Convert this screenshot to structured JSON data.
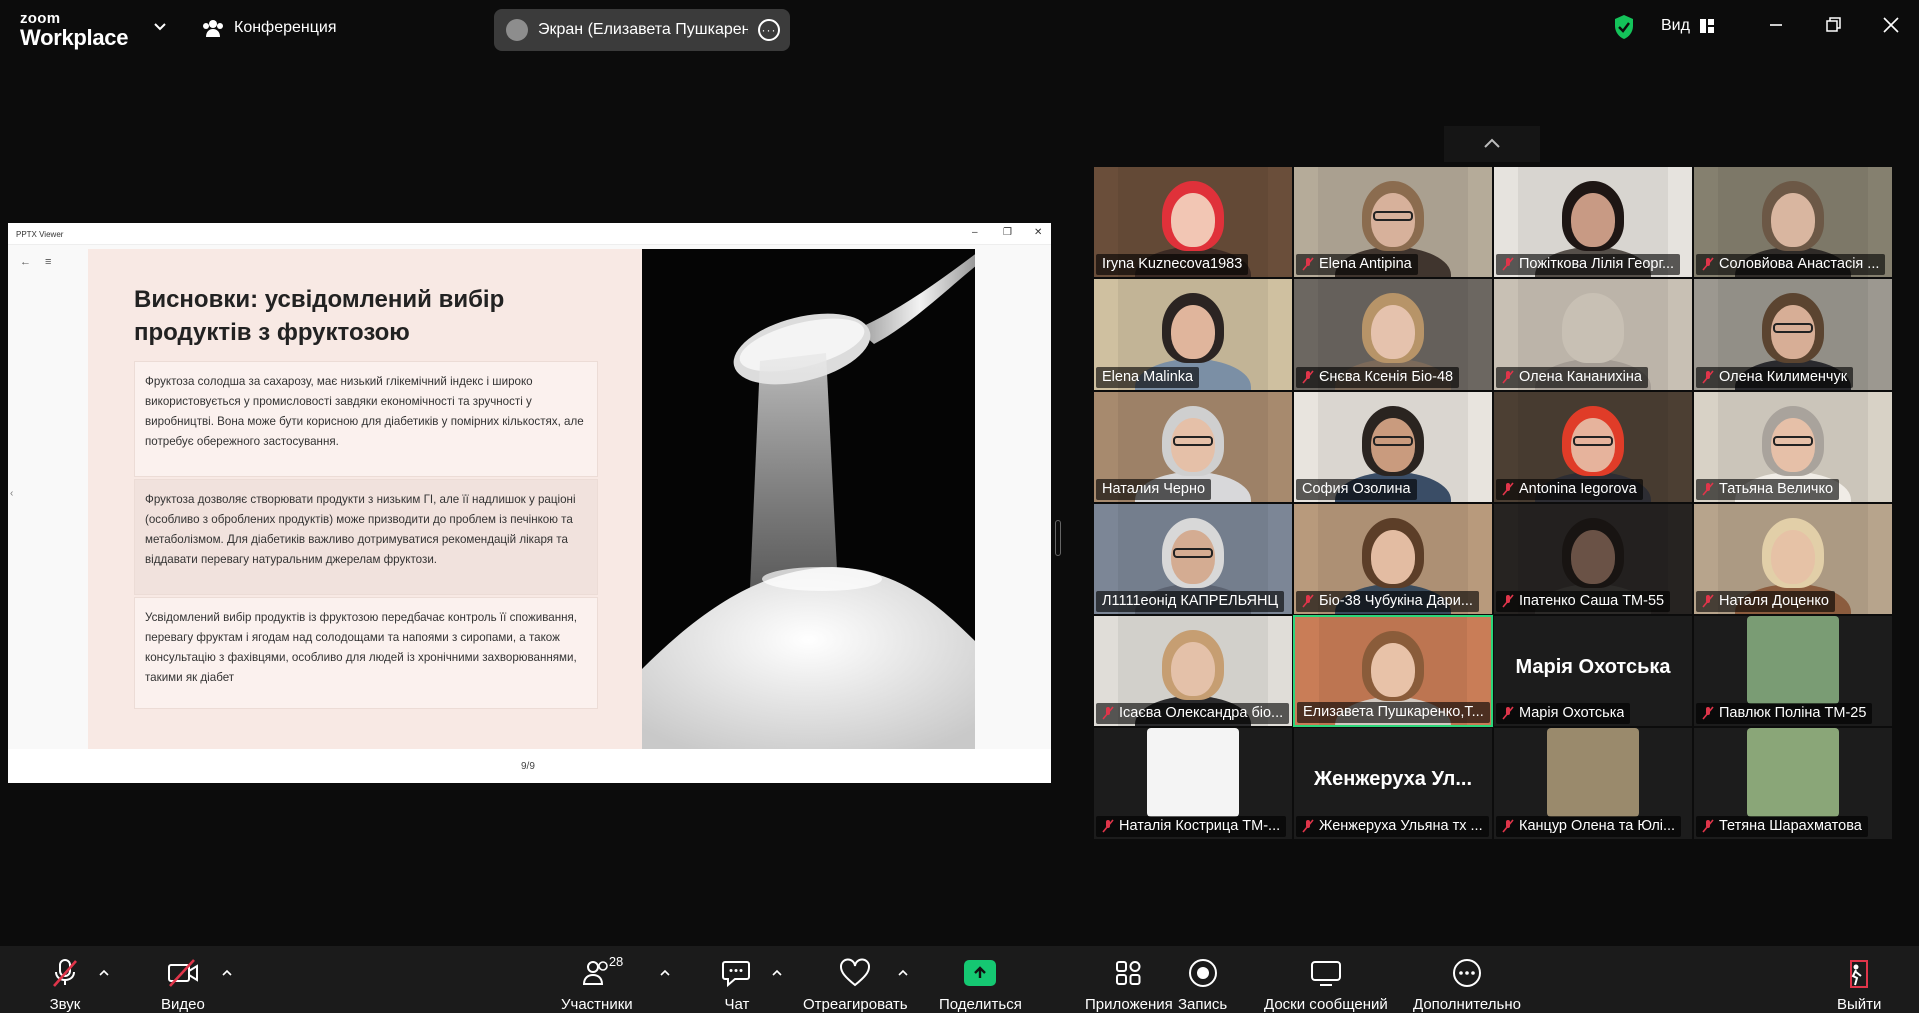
{
  "window": {
    "brand_top": "zoom",
    "brand_bottom": "Workplace",
    "meeting_label": "Конференция",
    "screen_share_label": "Экран (Елизавета Пушкаренко,",
    "view_label": "Вид"
  },
  "shared": {
    "app_title": "PPTX Viewer",
    "slide_title": "Висновки: усвідомлений вибір продуктів з фруктозою",
    "paragraphs": [
      "Фруктоза солодша за сахарозу, має низький глікемічний індекс і широко використовується у промисловості завдяки економічності та зручності у виробництві. Вона може бути корисною для діабетиків у помірних кількостях, але потребує обережного застосування.",
      "Фруктоза дозволяє створювати продукти з низьким ГІ, але її надлишок у раціоні (особливо з оброблених продуктів) може призводити до проблем із печінкою та метаболізмом. Для діабетиків важливо дотримуватися рекомендацій лікаря та віддавати перевагу натуральним джерелам фруктози.",
      "Усвідомлений вибір продуктів із фруктозою передбачає контроль її споживання, перевагу фруктам і ягодам над солодощами та напоями з сиропами, а також консультацію  з фахівцями, особливо для людей із хронічними захворюваннями, такими як діабет"
    ],
    "page_indicator": "9/9"
  },
  "participants": [
    {
      "name": "Iryna Kuznecova1983",
      "muted": false,
      "bg": "#6a4e3a",
      "hair": "#e0313a",
      "shirt": "#3b2a24",
      "face": "#f2c6b4",
      "glasses": false
    },
    {
      "name": "Elena Antipina",
      "muted": true,
      "bg": "#b5ab99",
      "hair": "#8b6c4f",
      "shirt": "#40352e",
      "face": "#d7b19b",
      "glasses": true
    },
    {
      "name": "Пожіткова Лілія Георг...",
      "muted": true,
      "bg": "#e6e3de",
      "hair": "#1e1614",
      "shirt": "#56504a",
      "face": "#c89a84",
      "glasses": false
    },
    {
      "name": "Соловйова Анастасія ...",
      "muted": true,
      "bg": "#85806f",
      "hair": "#6c5846",
      "shirt": "#2f2b28",
      "face": "#d9b6a0",
      "glasses": false
    },
    {
      "name": "Elena Malinka",
      "muted": false,
      "bg": "#cfc0a0",
      "hair": "#2b2422",
      "shirt": "#7b8fa5",
      "face": "#e0b59c",
      "glasses": false
    },
    {
      "name": "Єнєва Ксенія Біо-48",
      "muted": true,
      "bg": "#6c6761",
      "hair": "#b79468",
      "shirt": "#7c6a5a",
      "face": "#e5c2ad",
      "glasses": false
    },
    {
      "name": "Олена Кананихіна",
      "muted": true,
      "bg": "#c8c0b4",
      "hair": "#c8c0b4",
      "shirt": "#a49c94",
      "face": "#c8c0b4",
      "glasses": false
    },
    {
      "name": "Олена Килименчук",
      "muted": true,
      "bg": "#9c9890",
      "hair": "#5b4430",
      "shirt": "#2a2a2e",
      "face": "#d7ae96",
      "glasses": true
    },
    {
      "name": "Наталия Черно",
      "muted": false,
      "bg": "#a78a6e",
      "hair": "#cfcfcf",
      "shirt": "#d8d8da",
      "face": "#e5c0a8",
      "glasses": true
    },
    {
      "name": "София Озолина",
      "muted": false,
      "bg": "#e8e4de",
      "hair": "#2a2420",
      "shirt": "#3a4d66",
      "face": "#c99b7e",
      "glasses": true
    },
    {
      "name": "Antonina Iegorova",
      "muted": true,
      "bg": "#4c3f33",
      "hair": "#e03c28",
      "shirt": "#2d2d33",
      "face": "#e6b39c",
      "glasses": true
    },
    {
      "name": "Татьяна Величко",
      "muted": true,
      "bg": "#d8d2c6",
      "hair": "#a9a39c",
      "shirt": "#f0ece6",
      "face": "#e6c0a8",
      "glasses": true
    },
    {
      "name": "Л1111еонід КАПРЕЛЬЯНЦ",
      "muted": false,
      "bg": "#7c8696",
      "hair": "#d8d8d8",
      "shirt": "#5b6270",
      "face": "#d4ac92",
      "glasses": true
    },
    {
      "name": "Біо-38 Чубукіна Дари...",
      "muted": true,
      "bg": "#b89a7c",
      "hair": "#5c3e28",
      "shirt": "#3a4b5c",
      "face": "#e3bca2",
      "glasses": false
    },
    {
      "name": "Іпатенко Саша ТМ-55",
      "muted": true,
      "bg": "#262321",
      "hair": "#181412",
      "shirt": "#2c2a28",
      "face": "#6a5246",
      "glasses": false
    },
    {
      "name": "Наталя Доценко",
      "muted": true,
      "bg": "#b7a48c",
      "hair": "#e2cfa8",
      "shirt": "#8b5c3e",
      "face": "#e6c2a6",
      "glasses": false
    },
    {
      "name": "Ісаєва Олександра біо...",
      "muted": true,
      "bg": "#e0ddd8",
      "hair": "#c69e72",
      "shirt": "#2a2a2c",
      "face": "#e4c1a9",
      "glasses": false
    },
    {
      "name": "Елизавета Пушкаренко,Т...",
      "muted": false,
      "bg": "#c97d57",
      "hair": "#8a5c3a",
      "shirt": "#d2c8c0",
      "face": "#e8c2a8",
      "glasses": false,
      "speaking": true
    },
    {
      "name": "Марія Охотська",
      "muted": true,
      "bg": "#1c1c1c",
      "placeholder": "Марія Охотська"
    },
    {
      "name": "Павлюк Поліна ТМ-25",
      "muted": true,
      "bg": "#1c1c1c",
      "avatar": true,
      "avatar_bg": "#7a9c74"
    },
    {
      "name": "Наталія Кострица ТМ-...",
      "muted": true,
      "bg": "#1c1c1c",
      "avatar": true,
      "avatar_bg": "#f4f4f4"
    },
    {
      "name": "Женжеруха Ульяна тх ...",
      "muted": true,
      "bg": "#1c1c1c",
      "placeholder": "Женжеруха  Ул..."
    },
    {
      "name": "Канцур Олена та  Юлі...",
      "muted": true,
      "bg": "#1c1c1c",
      "avatar": true,
      "avatar_bg": "#9a8a6c"
    },
    {
      "name": "Тетяна Шарахматова",
      "muted": true,
      "bg": "#1c1c1c",
      "avatar": true,
      "avatar_bg": "#8aa678"
    }
  ],
  "toolbar": {
    "audio_label": "Звук",
    "video_label": "Видео",
    "participants_label": "Участники",
    "participants_count": "28",
    "chat_label": "Чат",
    "react_label": "Отреагировать",
    "share_label": "Поделиться",
    "apps_label": "Приложения",
    "record_label": "Запись",
    "whiteboards_label": "Доски сообщений",
    "more_label": "Дополнительно",
    "leave_label": "Выйти"
  },
  "colors": {
    "speaking_border": "#2bd67b",
    "muted_icon": "#e0354a",
    "share_button": "#15c872",
    "shield": "#14c35a"
  }
}
